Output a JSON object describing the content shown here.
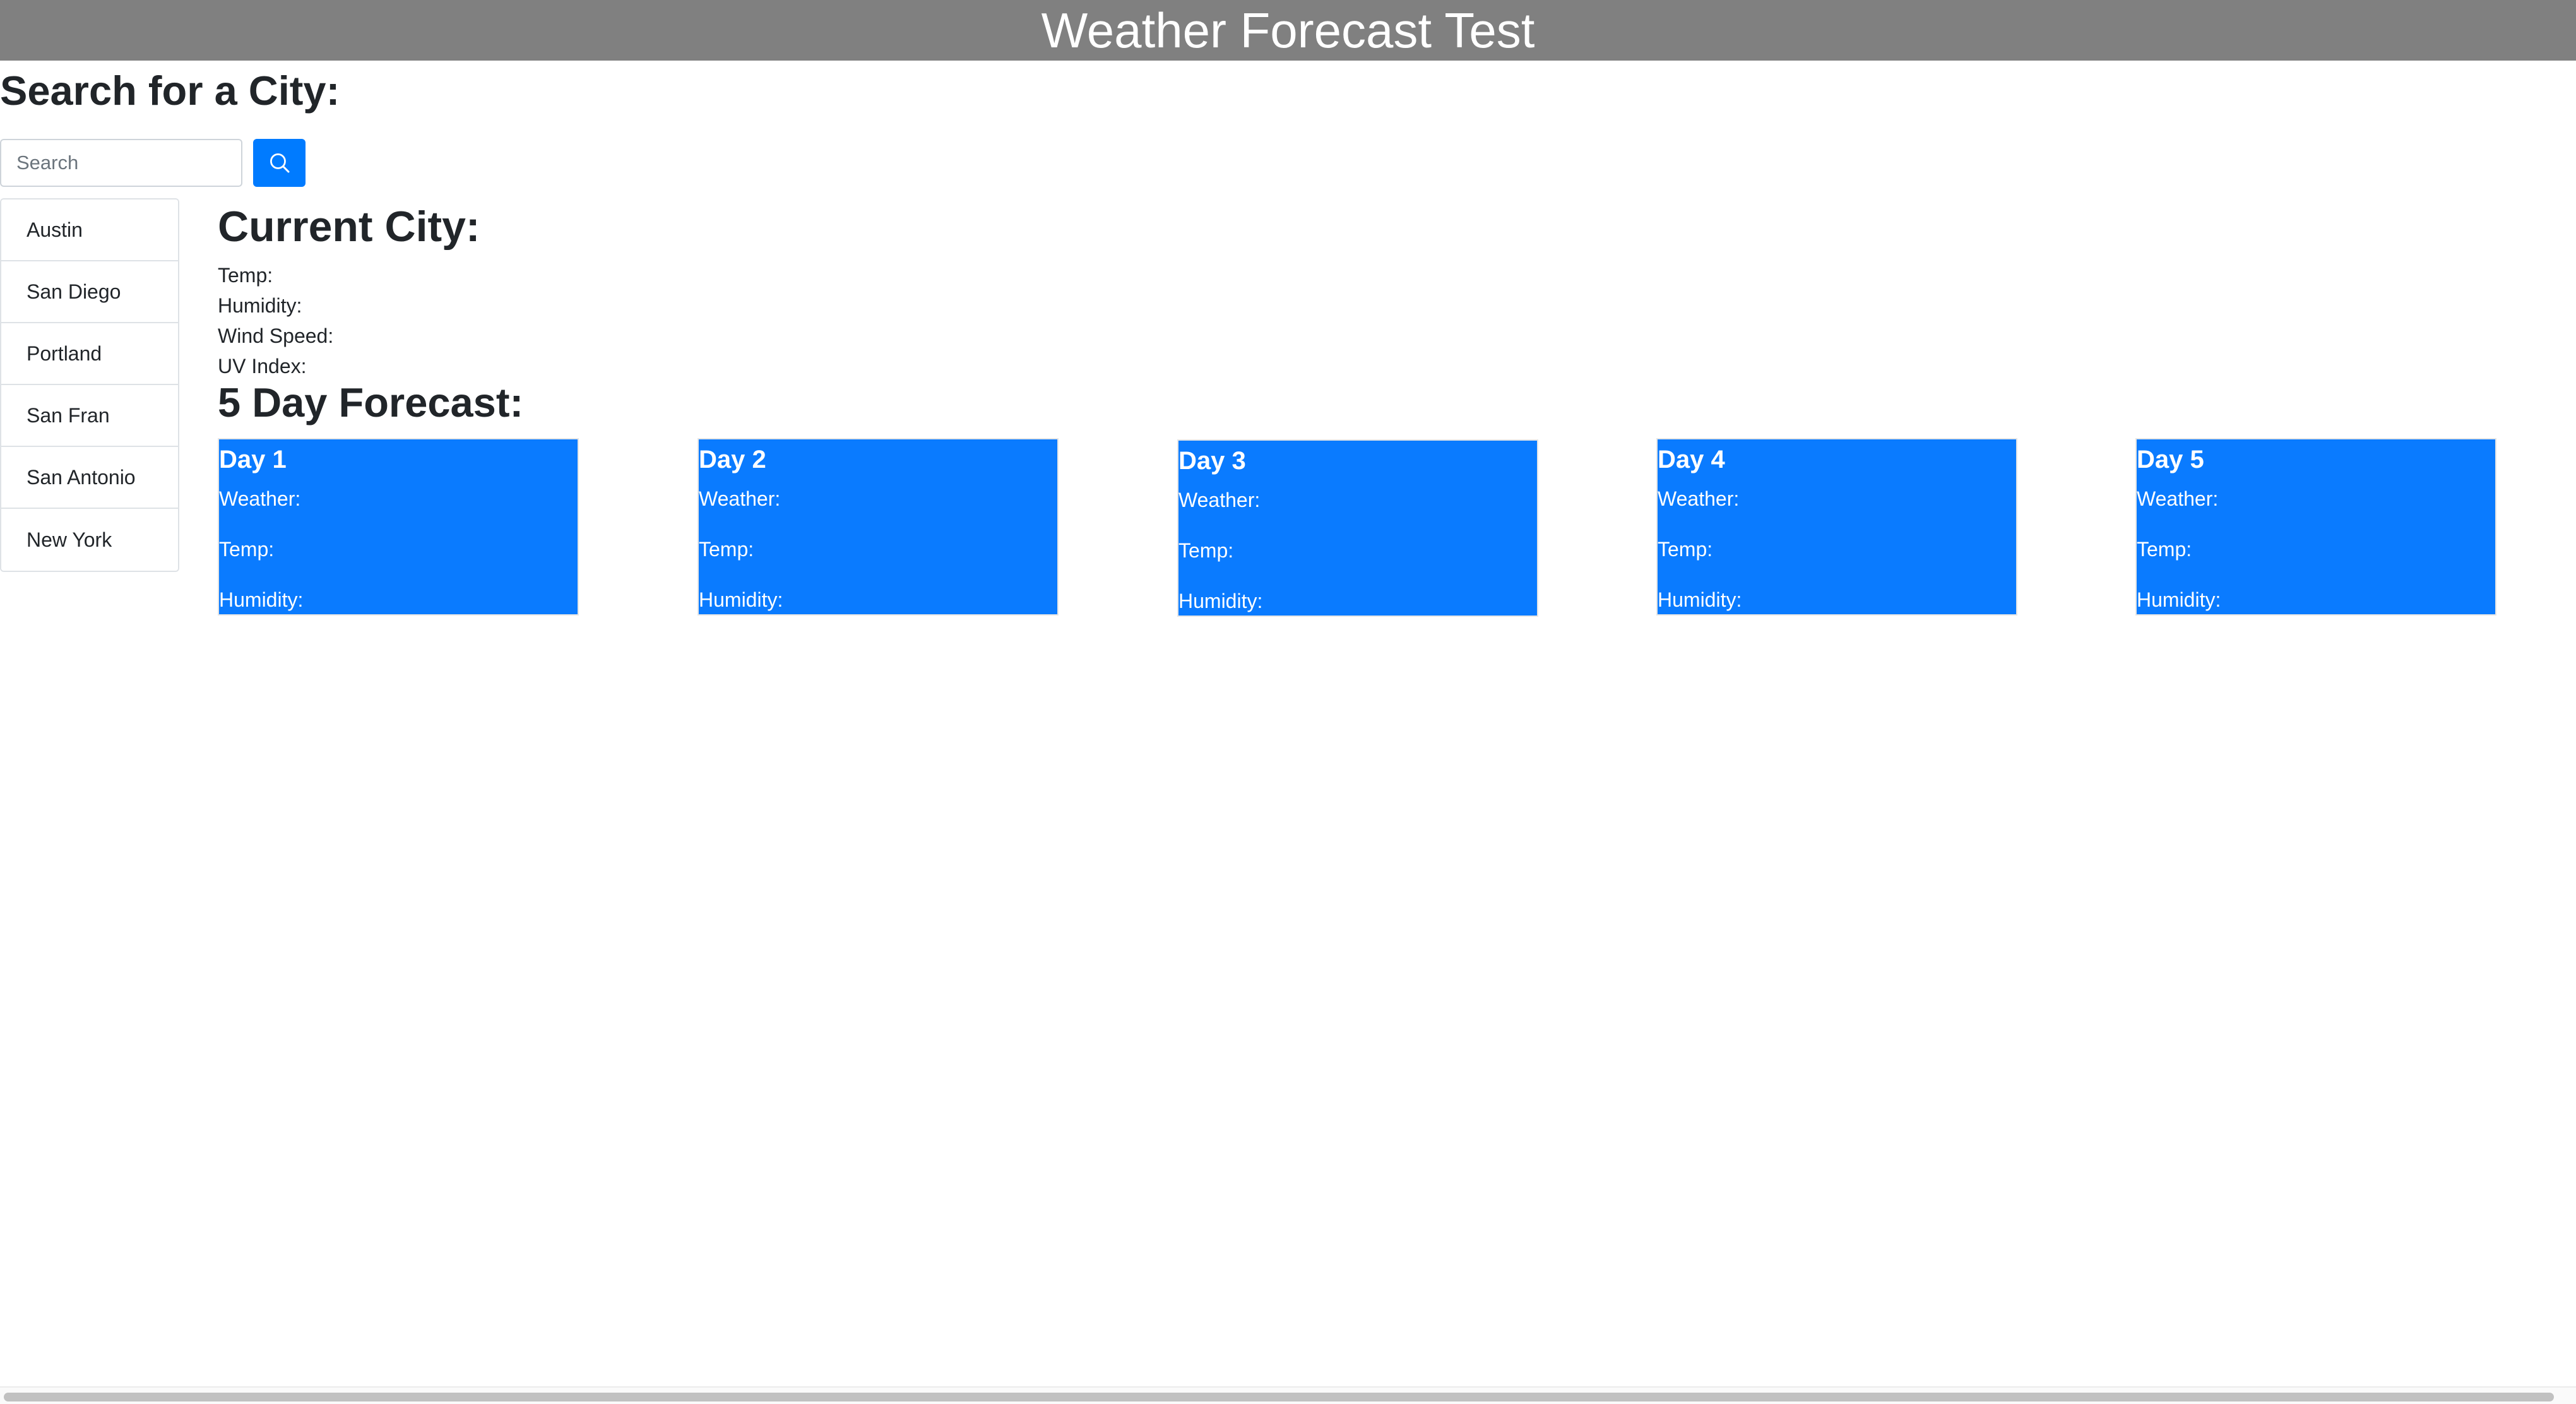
{
  "header": {
    "title": "Weather Forecast Test"
  },
  "search": {
    "heading": "Search for a City:",
    "placeholder": "Search",
    "value": "",
    "button_icon": "search-icon"
  },
  "cities": [
    "Austin",
    "San Diego",
    "Portland",
    "San Fran",
    "San Antonio",
    "New York"
  ],
  "current": {
    "heading": "Current City:",
    "temp_label": "Temp:",
    "humidity_label": "Humidity:",
    "wind_label": "Wind Speed:",
    "uv_label": "UV Index:"
  },
  "forecast": {
    "heading": "5 Day Forecast:",
    "days": [
      {
        "title": "Day 1",
        "weather": "Weather:",
        "temp": "Temp:",
        "humidity": "Humidity:"
      },
      {
        "title": "Day 2",
        "weather": "Weather:",
        "temp": "Temp:",
        "humidity": "Humidity:"
      },
      {
        "title": "Day 3",
        "weather": "Weather:",
        "temp": "Temp:",
        "humidity": "Humidity:"
      },
      {
        "title": "Day 4",
        "weather": "Weather:",
        "temp": "Temp:",
        "humidity": "Humidity:"
      },
      {
        "title": "Day 5",
        "weather": "Weather:",
        "temp": "Temp:",
        "humidity": "Humidity:"
      }
    ]
  },
  "colors": {
    "header_bg": "#808080",
    "accent": "#007bff",
    "card_bg": "#0a7bff"
  }
}
